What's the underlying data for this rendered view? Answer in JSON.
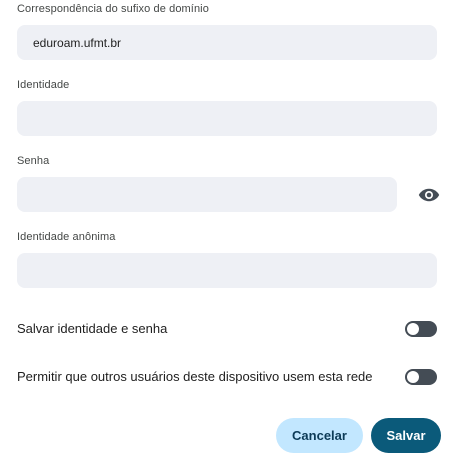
{
  "form": {
    "domain_suffix": {
      "label": "Correspondência do sufixo de domínio",
      "value": "eduroam.ufmt.br",
      "placeholder": ""
    },
    "identity": {
      "label": "Identidade",
      "value": "",
      "placeholder": ""
    },
    "password": {
      "label": "Senha",
      "value": "",
      "placeholder": "",
      "reveal_icon": "eye-icon"
    },
    "anonymous_identity": {
      "label": "Identidade anônima",
      "value": "",
      "placeholder": ""
    }
  },
  "toggles": {
    "save_credentials": {
      "label": "Salvar identidade e senha",
      "state": "off"
    },
    "share_network": {
      "label": "Permitir que outros usuários deste dispositivo usem esta rede",
      "state": "off"
    }
  },
  "actions": {
    "cancel_label": "Cancelar",
    "save_label": "Salvar"
  },
  "colors": {
    "field_bg": "#eef0f5",
    "toggle_track": "#444c55",
    "cancel_bg": "#c2e7ff",
    "save_bg": "#0b5a7a"
  }
}
